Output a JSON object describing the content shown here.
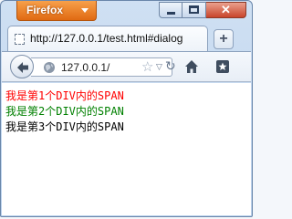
{
  "window": {
    "app_button_label": "Firefox",
    "close_glyph": "✕"
  },
  "tabs": [
    {
      "title": "http://127.0.0.1/test.html#dialog"
    }
  ],
  "newtab_label": "+",
  "toolbar": {
    "url": "127.0.0.1/",
    "icons": [
      "back-arrow-icon",
      "globe-icon",
      "star-icon",
      "dropdown-icon",
      "reload-icon",
      "home-icon",
      "bookmarks-icon"
    ]
  },
  "content": {
    "lines": [
      {
        "text": "我是第1个DIV内的SPAN",
        "color": "#ff0000"
      },
      {
        "text": "我是第2个DIV内的SPAN",
        "color": "#008000"
      },
      {
        "text": "我是第3个DIV内的SPAN",
        "color": "#000000"
      }
    ]
  }
}
